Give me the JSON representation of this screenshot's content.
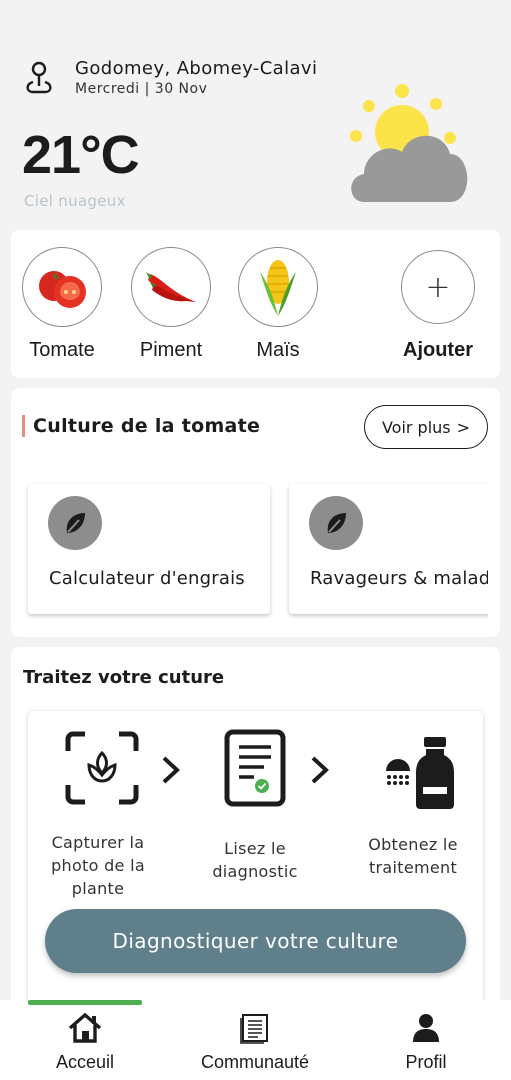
{
  "location": {
    "city": "Godomey, Abomey-Calavi",
    "date": "Mercredi | 30 Nov",
    "icon": "location-pin-icon"
  },
  "weather": {
    "temperature": "21°C",
    "condition": "Ciel nuageux",
    "icon": "partly-cloudy-icon",
    "sun_color": "#fbe44a",
    "cloud_color": "#999999"
  },
  "crops": [
    {
      "label": "Tomate",
      "icon": "tomato-icon"
    },
    {
      "label": "Piment",
      "icon": "chili-pepper-icon"
    },
    {
      "label": "Maïs",
      "icon": "corn-icon"
    }
  ],
  "add_crop": {
    "symbol": "+",
    "label": "Ajouter"
  },
  "culture": {
    "title": "Culture de la tomate",
    "more_label": "Voir plus",
    "more_symbol": ">",
    "tools": [
      {
        "label": "Calculateur d'engrais",
        "icon": "leaf-icon"
      },
      {
        "label": "Ravageurs & maladies",
        "icon": "leaf-icon"
      }
    ]
  },
  "treat": {
    "title": "Traitez votre cuture",
    "steps": [
      {
        "label": "Capturer la photo de la plante",
        "icon": "scan-plant-icon"
      },
      {
        "label": "Lisez le diagnostic",
        "icon": "report-icon"
      },
      {
        "label": "Obtenez le traitement",
        "icon": "sprayer-bottle-icon"
      }
    ],
    "button_label": "Diagnostiquer votre culture"
  },
  "nav": {
    "items": [
      {
        "label": "Acceuil",
        "icon": "home-icon"
      },
      {
        "label": "Communauté",
        "icon": "newspaper-icon"
      },
      {
        "label": "Profil",
        "icon": "user-icon"
      }
    ],
    "active_index": 0,
    "active_color": "#4caf50"
  },
  "colors": {
    "accent": "#5f7f8a",
    "title_accent": "#e88c84",
    "active": "#4caf50"
  }
}
